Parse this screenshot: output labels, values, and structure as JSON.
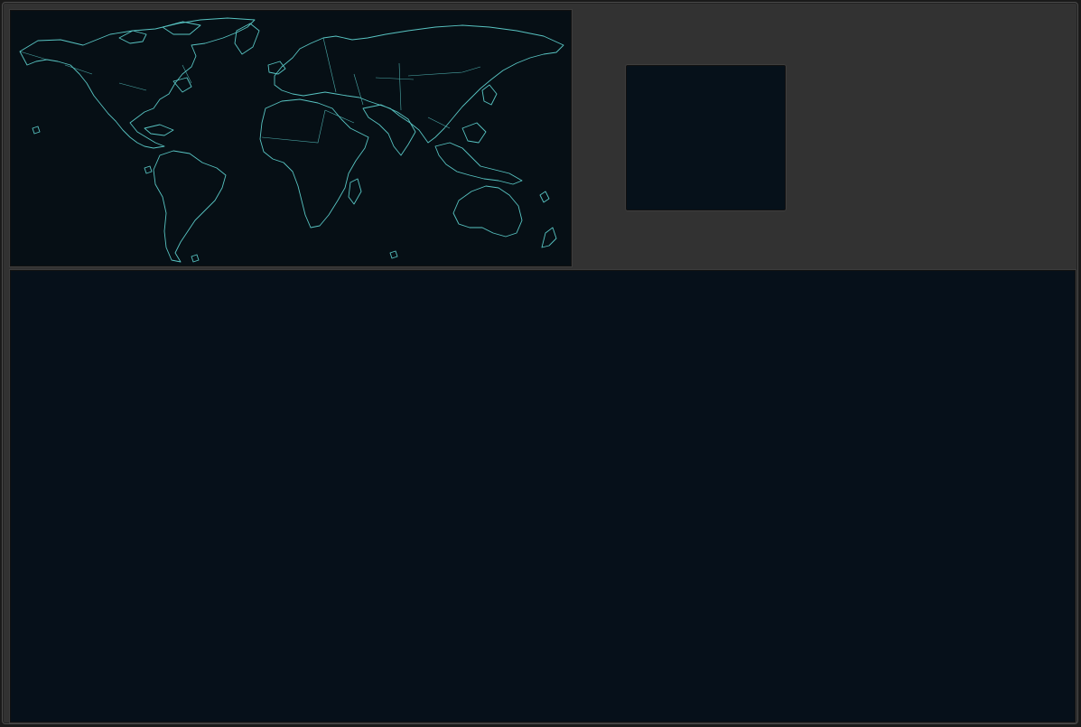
{
  "app": {
    "accent_color": "#58c4c2",
    "panel_background": "#060f15",
    "window_background": "#323232"
  },
  "world_map": {
    "icon": "world-map-outline"
  }
}
